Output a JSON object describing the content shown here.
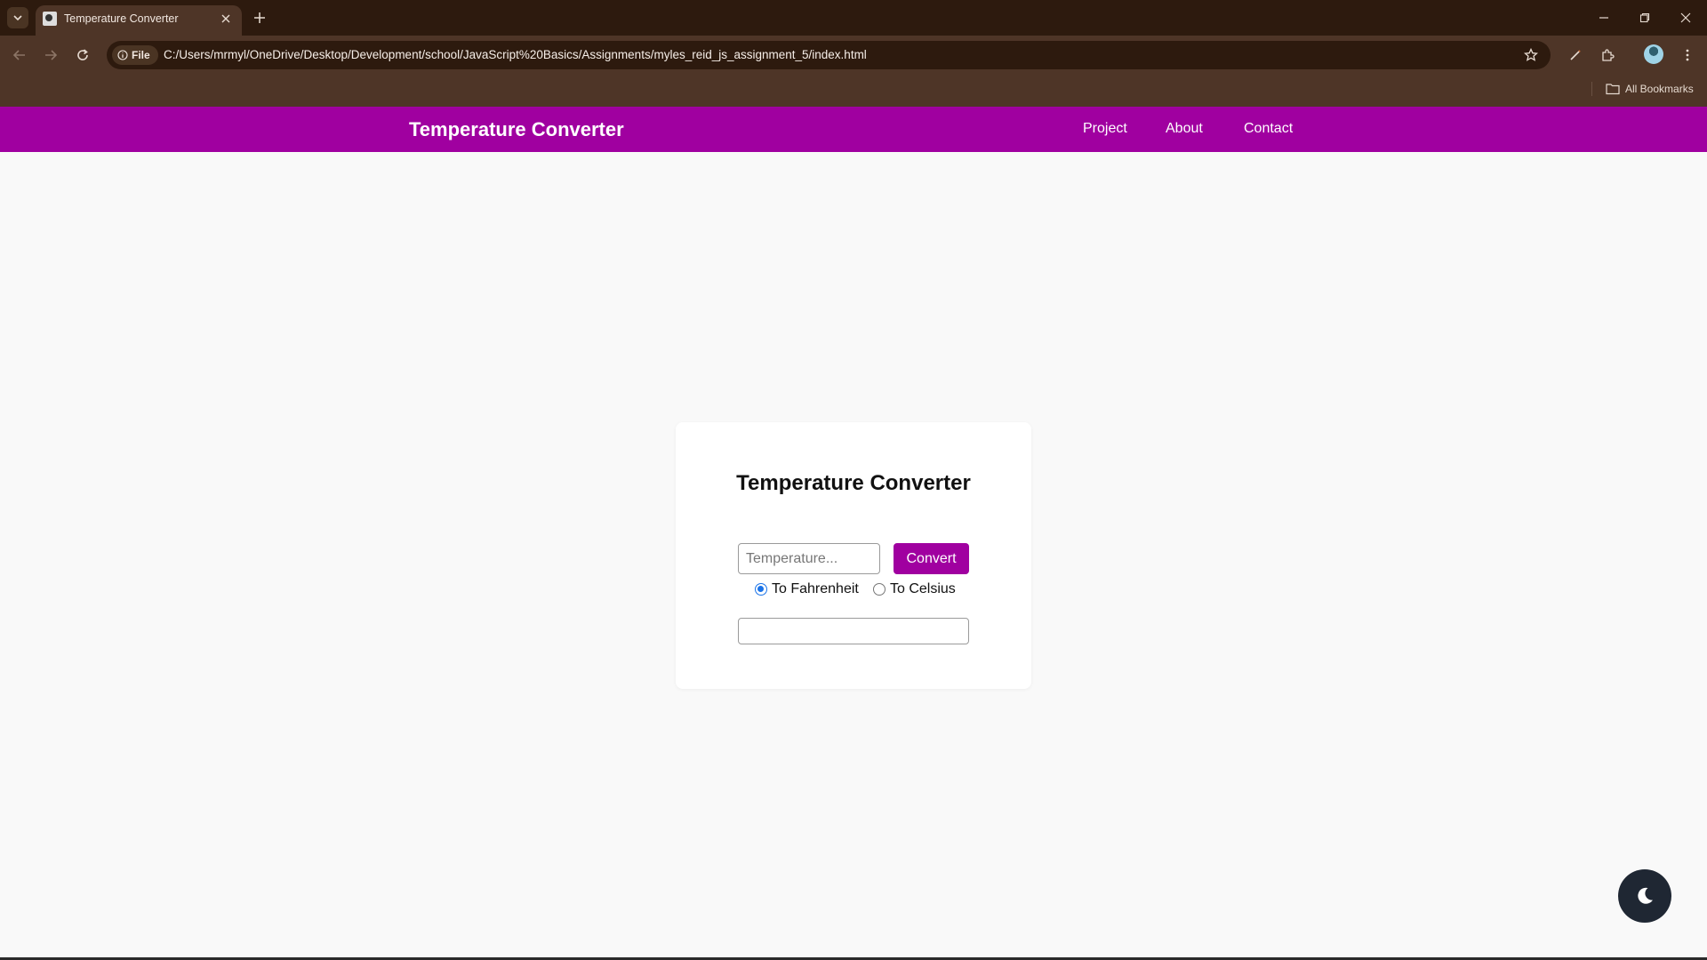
{
  "browser": {
    "tab_title": "Temperature Converter",
    "site_chip": "File",
    "url": "C:/Users/mrmyl/OneDrive/Desktop/Development/school/JavaScript%20Basics/Assignments/myles_reid_js_assignment_5/index.html",
    "bookmarks_label": "All Bookmarks",
    "icons": [
      "tab-search-icon",
      "favicon-icon",
      "close-icon",
      "plus-icon",
      "minimize-icon",
      "restore-icon",
      "window-close-icon",
      "back-icon",
      "forward-icon",
      "reload-icon",
      "info-icon",
      "star-icon",
      "pen-icon",
      "extensions-icon",
      "profile-avatar",
      "menu-dots-icon",
      "folder-icon"
    ]
  },
  "site": {
    "brand": "Temperature Converter",
    "nav": [
      "Project",
      "About",
      "Contact"
    ],
    "accent_color": "#a000a0"
  },
  "converter": {
    "title": "Temperature Converter",
    "input_placeholder": "Temperature...",
    "input_value": "",
    "button_label": "Convert",
    "options": [
      {
        "label": "To Fahrenheit",
        "checked": true
      },
      {
        "label": "To Celsius",
        "checked": false
      }
    ],
    "result": ""
  },
  "theme_toggle": {
    "icon": "moon-icon"
  }
}
